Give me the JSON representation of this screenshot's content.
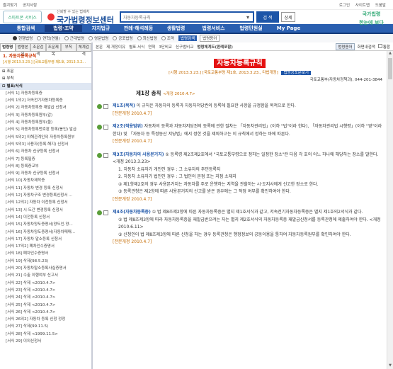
{
  "topbar": {
    "left": [
      "즐겨찾기",
      "공지사항"
    ],
    "right": [
      "로그인",
      "사이트맵",
      "도움말"
    ]
  },
  "header": {
    "logo_small": "스마트폰 서비스",
    "slogan": "신뢰할 수 있는 법제처",
    "brand": "국가법령정보센터",
    "search_value": "자동차등록규칙",
    "search_button": "검 색",
    "detail_button": "상세",
    "ad_text_1": "국가법령",
    "ad_text_2": "한눈에 보다"
  },
  "nav": [
    "통합검색",
    "법령·조약",
    "자치법규",
    "판례·해석례등",
    "생활법령",
    "법령서비스",
    "법령민원실",
    "My Page"
  ],
  "options": {
    "radios": [
      "현행법령",
      "연혁(연월)",
      "근대법령",
      "영문법령",
      "공포법령",
      "최신법령",
      "조약"
    ],
    "btn_primary": "법령검색",
    "btn_secondary": "법령용어",
    "selected_index": 0
  },
  "sidebar": {
    "tabs": [
      "법령명",
      "법령본문",
      "조문검색",
      "조문제목",
      "부칙",
      "체계검색"
    ],
    "title": "1. 자동차등록규칙",
    "subtitle": "[시행 2013.3.23.] [국토교통부령 제1호, 2013.3.2...",
    "tree": [
      {
        "t": "⊞ 조문",
        "sec": true
      },
      {
        "t": "⊞ 부칙",
        "sec": true
      },
      {
        "t": "⊟ 별표/서식",
        "sec": true,
        "sel": true
      },
      {
        "t": "[서식 1] 자동차등록증"
      },
      {
        "t": "[서식 1의2] 저속전기자동차등록증"
      },
      {
        "t": "[서식 2] 자동차등록증 재발급 신청서"
      },
      {
        "t": "[서식 3] 자동차등록원부(갑)"
      },
      {
        "t": "[서식 4] 자동차등록원부(을)"
      },
      {
        "t": "[서식 5] 자동차등록번호판 등록(봉인) 발급"
      },
      {
        "t": "[서식 5의2] 이해관계인의 자동차등록원부"
      },
      {
        "t": "[서식 5의3] 사용자(등록·해지) 신청서"
      },
      {
        "t": "[서식 6] 자동차 신규등록 신청서"
      },
      {
        "t": "[서식 7] 등록필증"
      },
      {
        "t": "[서식 8] 등록증교부"
      },
      {
        "t": "[서식 9] 자동차 신규등록 신청서"
      },
      {
        "t": "[서식 10] 자동차제작증"
      },
      {
        "t": "[서식 11] 자동차 변경 등록 신청서"
      },
      {
        "t": "[서식 12] 자동차구조 변경등록신청서 ..."
      },
      {
        "t": "[서식 12의2] 자동차 이전등록 신청서"
      },
      {
        "t": "[서식 13] 시·도간 변경등록 신청서"
      },
      {
        "t": "[서식 14] 이전등록 신청서"
      },
      {
        "t": "[서식 15] 자동차양도증명서(양도인·양..."
      },
      {
        "t": "[서식 16] 자동차양도증명서(자동차매매..."
      },
      {
        "t": "[서식 17] 자동차 말소등록 신청서"
      },
      {
        "t": "[서식 17의2] 폐차인수증명서"
      },
      {
        "t": "[서식 18] 폐차인수증명서"
      },
      {
        "t": "[서식 19] 삭제(98.5.23)"
      },
      {
        "t": "[서식 20] 자동차말소등록사실증명서"
      },
      {
        "t": "[서식 21] 수출 이행여부 신고서"
      },
      {
        "t": "[서식 22] 삭제 <2010.4.7>"
      },
      {
        "t": "[서식 23] 삭제 <2010.4.7>"
      },
      {
        "t": "[서식 24] 삭제 <2010.4.7>"
      },
      {
        "t": "[서식 25] 삭제 <2010.4.7>"
      },
      {
        "t": "[서식 26] 삭제 <2010.4.7>"
      },
      {
        "t": "[서식 26의2] 자동차 등록 신청 정정"
      },
      {
        "t": "[서식 27] 삭제(99.11.5)"
      },
      {
        "t": "[서식 28] 삭제 <1999.11.5>"
      },
      {
        "t": "[서식 29] 이의신청서"
      }
    ]
  },
  "toolbar": {
    "tools": [
      "본문",
      "제·개정이유",
      "별표·서식",
      "연혁",
      "3단비교",
      "신구법비교",
      "법령체계도(판례포함)"
    ],
    "bold_index": 6,
    "right_btn": "법령용어",
    "right_label": "화면내검색",
    "right_chk": "통합"
  },
  "doc": {
    "title": "자동차등록규칙",
    "info": "[시행 2013.3.23.] [국토교통부령 제1호, 2013.3.23., 타법개정]",
    "info_btn": "법령공포문보기",
    "ministry": "국토교통부(자동차정책과), 044-201-3844",
    "chapter": "제1장 총칙",
    "chapter_rev": "<개정 2010.4.7>",
    "articles": [
      {
        "head": "제1조(목적)",
        "text": "이 규칙은 자동차의 등록과 자동차저당권의 등록에 필요한 사항을 규정함을 목적으로 한다.",
        "extra": [],
        "rev": "[전문개정 2010.4.7]"
      },
      {
        "head": "제2조(적용범위)",
        "text": "자동차의 등록과 자동차저당권의 등록에 관한 절차는 「자동차관리법」(이하 \"법\"이라 한다), 「자동차관리법 시행령」(이하 \"영\"이라 한다) 및 「자동차 등 특정동산 저당법」에서 정한 것을 제외하고는 이 규칙에서 정하는 바에 따른다.",
        "extra": [],
        "rev": "[전문개정 2010.4.7]"
      },
      {
        "head": "제3조(자동차의 사용본거지)",
        "text": "① 등록령 제2조제2호에서 \"국토교통부령으로 정하는 일정한 장소\"란 다음 각 호의 어느 하나에 해당하는 장소를 말한다. <개정 2013.3.23>",
        "extra": [
          "1. 자동차 소유자가 개인인 경우 : 그 소유자의 주민등록지",
          "2. 자동차 소유자가 법인인 경우 : 그 법인의 본점 또는 지점 소재지",
          "② 제1항제2호의 경우 사용본거지는 자동차를 주로 운행하는 지역을 관할하는 시·도지사에게 신고한 장소로 한다.",
          "③ 등록관청은 제2항에 따른 사용본거지의 신고를 받은 경우에는 그 적정 여부를 확인하여야 한다."
        ],
        "rev": "[전문개정 2010.4.7]"
      },
      {
        "head": "제4조(자동차등록증)",
        "text": "① 법 제8조제2항에 따른 자동차등록증은 별지 제1호서식과 같고, 저속전기자동차등록증은 별지 제1호의2서식과 같다.",
        "extra": [
          "② 법 제8조제3항에 따라 자동차등록증을 재발급받으려는 자는 별지 제2호서식의 자동차등록증 재발급신청서를 등록관청에 제출하여야 한다. <개정 2010.6.11>",
          "③ 신청인이 법 제8조제3항에 따른 신청을 하는 경우 등록관청은 행정정보의 공동이용을 통하여 자동차등록원부를 확인하여야 한다."
        ],
        "rev": "[전문개정 2010.4.7]"
      }
    ]
  }
}
